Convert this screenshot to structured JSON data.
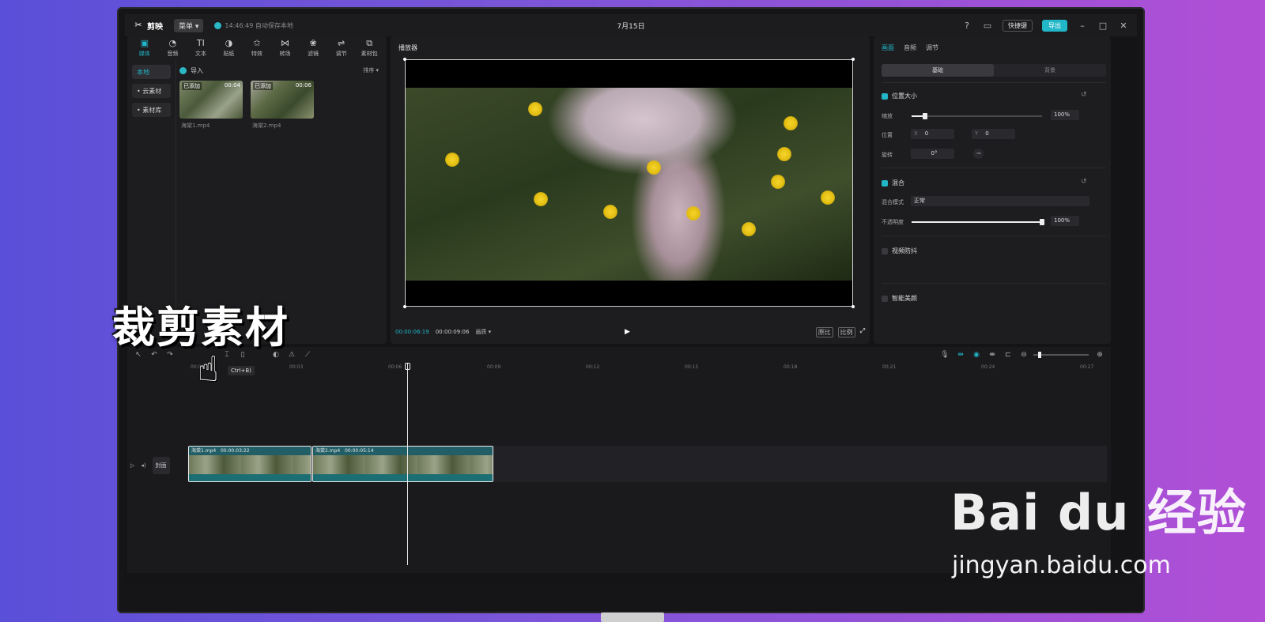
{
  "app": {
    "name": "剪映",
    "menu": "菜单",
    "autosave": "14:46:49 自动保存本地",
    "project_title": "7月15日",
    "shortcut": "快捷键",
    "export": "导出"
  },
  "toolbar": [
    {
      "label": "媒体",
      "icon": "media-icon",
      "glyph": "▣",
      "active": true
    },
    {
      "label": "音频",
      "icon": "audio-icon",
      "glyph": "◔",
      "active": false
    },
    {
      "label": "文本",
      "icon": "text-icon",
      "glyph": "TI",
      "active": false
    },
    {
      "label": "贴纸",
      "icon": "sticker-icon",
      "glyph": "◑",
      "active": false
    },
    {
      "label": "特效",
      "icon": "effects-icon",
      "glyph": "✩",
      "active": false
    },
    {
      "label": "转场",
      "icon": "transition-icon",
      "glyph": "⋈",
      "active": false
    },
    {
      "label": "滤镜",
      "icon": "filter-icon",
      "glyph": "❀",
      "active": false
    },
    {
      "label": "调节",
      "icon": "adjust-icon",
      "glyph": "⇌",
      "active": false
    },
    {
      "label": "素材包",
      "icon": "package-icon",
      "glyph": "⧉",
      "active": false
    }
  ],
  "left_nav": [
    {
      "label": "本地"
    },
    {
      "label": "• 云素材"
    },
    {
      "label": "• 素材库"
    }
  ],
  "media": {
    "import": "导入",
    "sort": "排序 ▾",
    "clips": [
      {
        "badge": "已添加",
        "duration": "00:04",
        "name": "海棠1.mp4"
      },
      {
        "badge": "已添加",
        "duration": "00:06",
        "name": "海棠2.mp4"
      }
    ]
  },
  "player": {
    "title": "播放器",
    "current": "00:00:06:19",
    "total": "00:00:09:06",
    "option": "画质 ▾",
    "btn_a": "原比",
    "btn_b": "比例"
  },
  "props": {
    "tabs": [
      "画面",
      "音频",
      "调节"
    ],
    "seg": [
      "基础",
      "背景"
    ],
    "position_size": "位置大小",
    "scale_label": "缩放",
    "scale_value": "100%",
    "scale_level": 0.1,
    "position_label": "位置",
    "x_label": "X",
    "x_value": "0",
    "y_label": "Y",
    "y_value": "0",
    "rotate_label": "旋转",
    "rotate_value": "0°",
    "blend": "混合",
    "blend_mode_label": "混合模式",
    "blend_mode_value": "正常",
    "opacity_label": "不透明度",
    "opacity_value": "100%",
    "opacity_level": 1.0,
    "stabilize": "视频防抖",
    "beauty": "智能美颜"
  },
  "overlay_title": "裁剪素材",
  "tooltip": "Ctrl+B)",
  "timeline": {
    "ruler": [
      "00:00",
      "00:03",
      "00:06",
      "00:09",
      "00:12",
      "00:15",
      "00:18",
      "00:21",
      "00:24",
      "00:27"
    ],
    "cover": "封面",
    "clips": [
      {
        "name": "海棠1.mp4",
        "duration": "00:00:03:22"
      },
      {
        "name": "海棠2.mp4",
        "duration": "00:00:05:14"
      }
    ]
  },
  "watermark": {
    "brand": "Bai du 经验",
    "url": "jingyan.baidu.com"
  }
}
